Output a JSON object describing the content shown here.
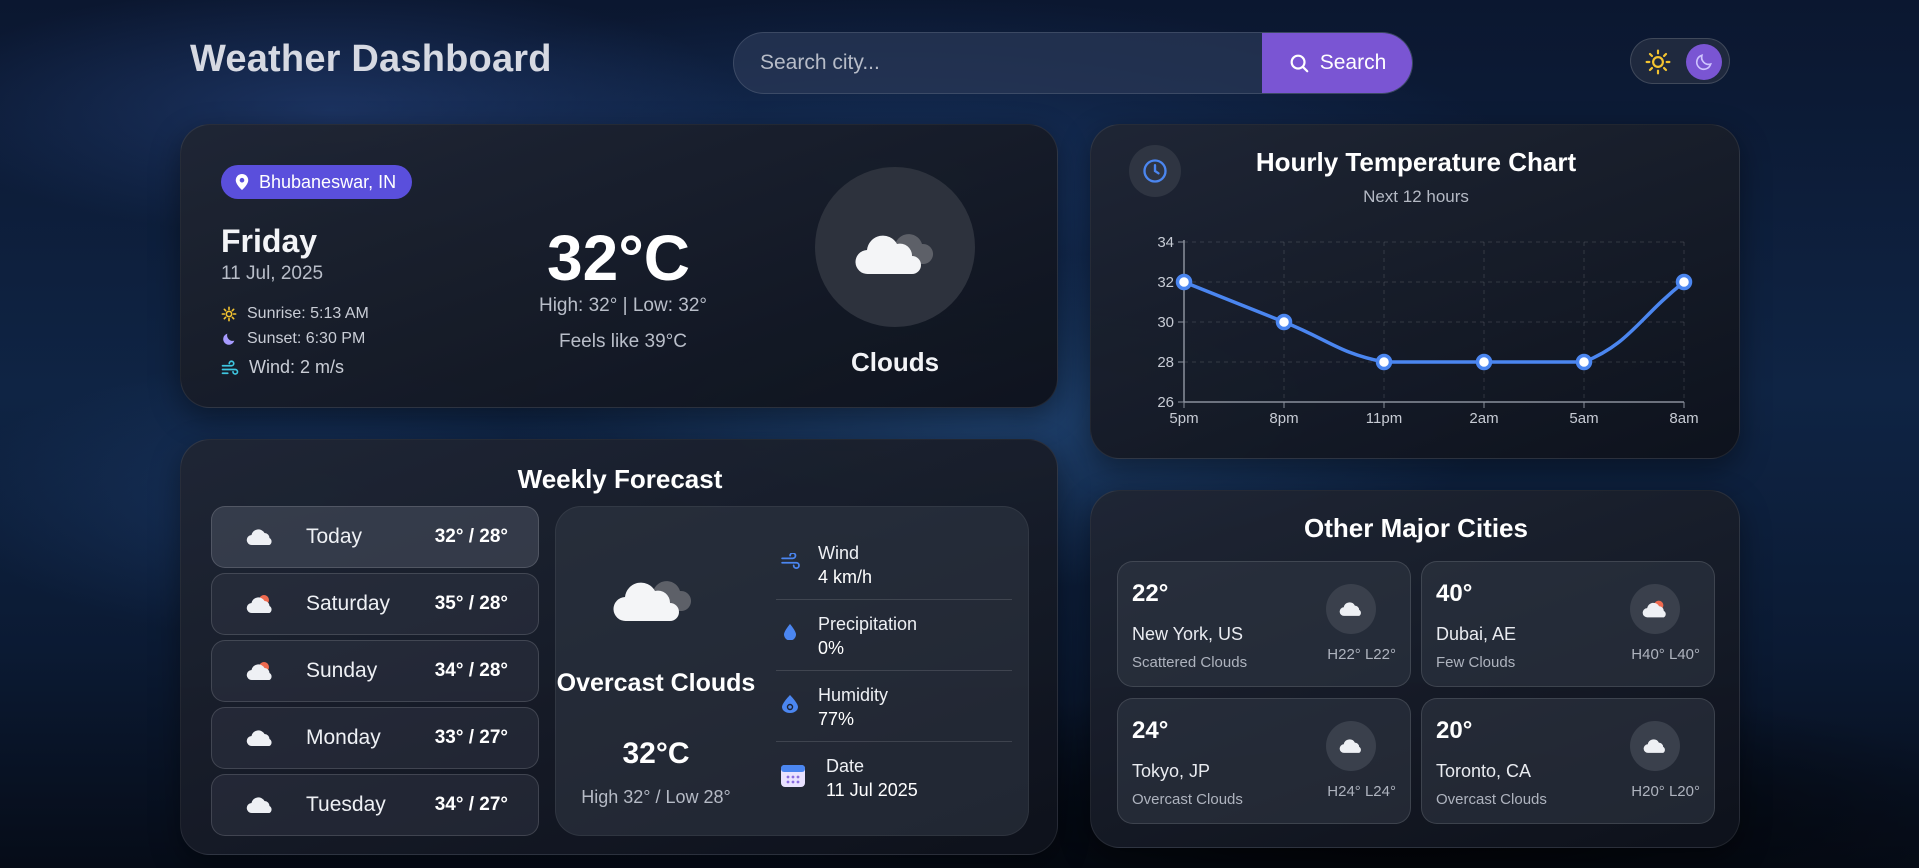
{
  "header": {
    "title": "Weather Dashboard",
    "search_placeholder": "Search city...",
    "search_label": "Search"
  },
  "theme": {
    "mode": "dark",
    "sun_icon": "sun-icon",
    "moon_icon": "moon-icon"
  },
  "current": {
    "location": "Bhubaneswar, IN",
    "day": "Friday",
    "date": "11 Jul, 2025",
    "sunrise": "Sunrise: 5:13 AM",
    "sunset": "Sunset: 6:30 PM",
    "wind": "Wind: 2 m/s",
    "temp": "32°C",
    "hilo": "High: 32° | Low: 32°",
    "feels": "Feels like 39°C",
    "condition": "Clouds",
    "icon": "clouds-icon"
  },
  "hourly": {
    "title": "Hourly Temperature Chart",
    "subtitle": "Next 12 hours"
  },
  "chart_data": {
    "type": "line",
    "title": "Hourly Temperature Chart",
    "subtitle": "Next 12 hours",
    "categories": [
      "5pm",
      "8pm",
      "11pm",
      "2am",
      "5am",
      "8am"
    ],
    "series": [
      {
        "values": [
          32,
          30,
          28,
          28,
          28,
          32
        ]
      }
    ],
    "ylim": [
      26,
      34
    ],
    "yticks": [
      26,
      28,
      30,
      32,
      34
    ],
    "grid": true,
    "color": "#4b86f0"
  },
  "weekly": {
    "title": "Weekly Forecast",
    "days": [
      {
        "name": "Today",
        "temps": "32° / 28°",
        "icon": "cloud-icon"
      },
      {
        "name": "Saturday",
        "temps": "35° / 28°",
        "icon": "sun-cloud-icon"
      },
      {
        "name": "Sunday",
        "temps": "34° / 28°",
        "icon": "sun-cloud-icon"
      },
      {
        "name": "Monday",
        "temps": "33° / 27°",
        "icon": "cloud-icon"
      },
      {
        "name": "Tuesday",
        "temps": "34° / 27°",
        "icon": "cloud-icon"
      }
    ],
    "detail": {
      "condition": "Overcast Clouds",
      "temp": "32°C",
      "hilo": "High 32° / Low 28°",
      "wind_label": "Wind",
      "wind_value": "4 km/h",
      "precip_label": "Precipitation",
      "precip_value": "0%",
      "humidity_label": "Humidity",
      "humidity_value": "77%",
      "date_label": "Date",
      "date_value": "11 Jul 2025"
    }
  },
  "cities": {
    "title": "Other Major Cities",
    "items": [
      {
        "temp": "22°",
        "name": "New York, US",
        "desc": "Scattered Clouds",
        "hl": "H22° L22°",
        "icon": "cloud-icon"
      },
      {
        "temp": "40°",
        "name": "Dubai, AE",
        "desc": "Few Clouds",
        "hl": "H40° L40°",
        "icon": "sun-cloud-icon"
      },
      {
        "temp": "24°",
        "name": "Tokyo, JP",
        "desc": "Overcast Clouds",
        "hl": "H24° L24°",
        "icon": "cloud-icon"
      },
      {
        "temp": "20°",
        "name": "Toronto, CA",
        "desc": "Overcast Clouds",
        "hl": "H20° L20°",
        "icon": "cloud-icon"
      }
    ]
  },
  "colors": {
    "accent": "#7a55d3",
    "location_badge": "#5a4fdc",
    "chart_line": "#4b86f0"
  }
}
